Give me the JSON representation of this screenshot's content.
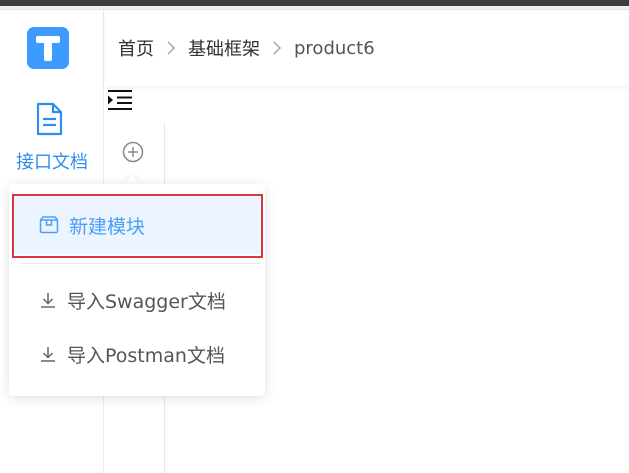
{
  "sidebar": {
    "logo_icon": "t-logo-icon",
    "nav_item": {
      "label": "接口文档",
      "icon": "document-icon"
    }
  },
  "header": {
    "breadcrumb": [
      "首页",
      "基础框架",
      "product6"
    ]
  },
  "toolbar": {
    "collapse_icon": "indent-icon",
    "add_icon": "plus-circle-icon"
  },
  "dropdown_menu": {
    "items": [
      {
        "label": "新建模块",
        "icon": "package-icon",
        "active": true
      },
      {
        "label": "导入Swagger文档",
        "icon": "download-icon"
      },
      {
        "label": "导入Postman文档",
        "icon": "download-icon"
      }
    ]
  },
  "colors": {
    "accent": "#3d9bff",
    "active_bg": "#ebf4ff",
    "highlight_border": "#d9383c"
  }
}
